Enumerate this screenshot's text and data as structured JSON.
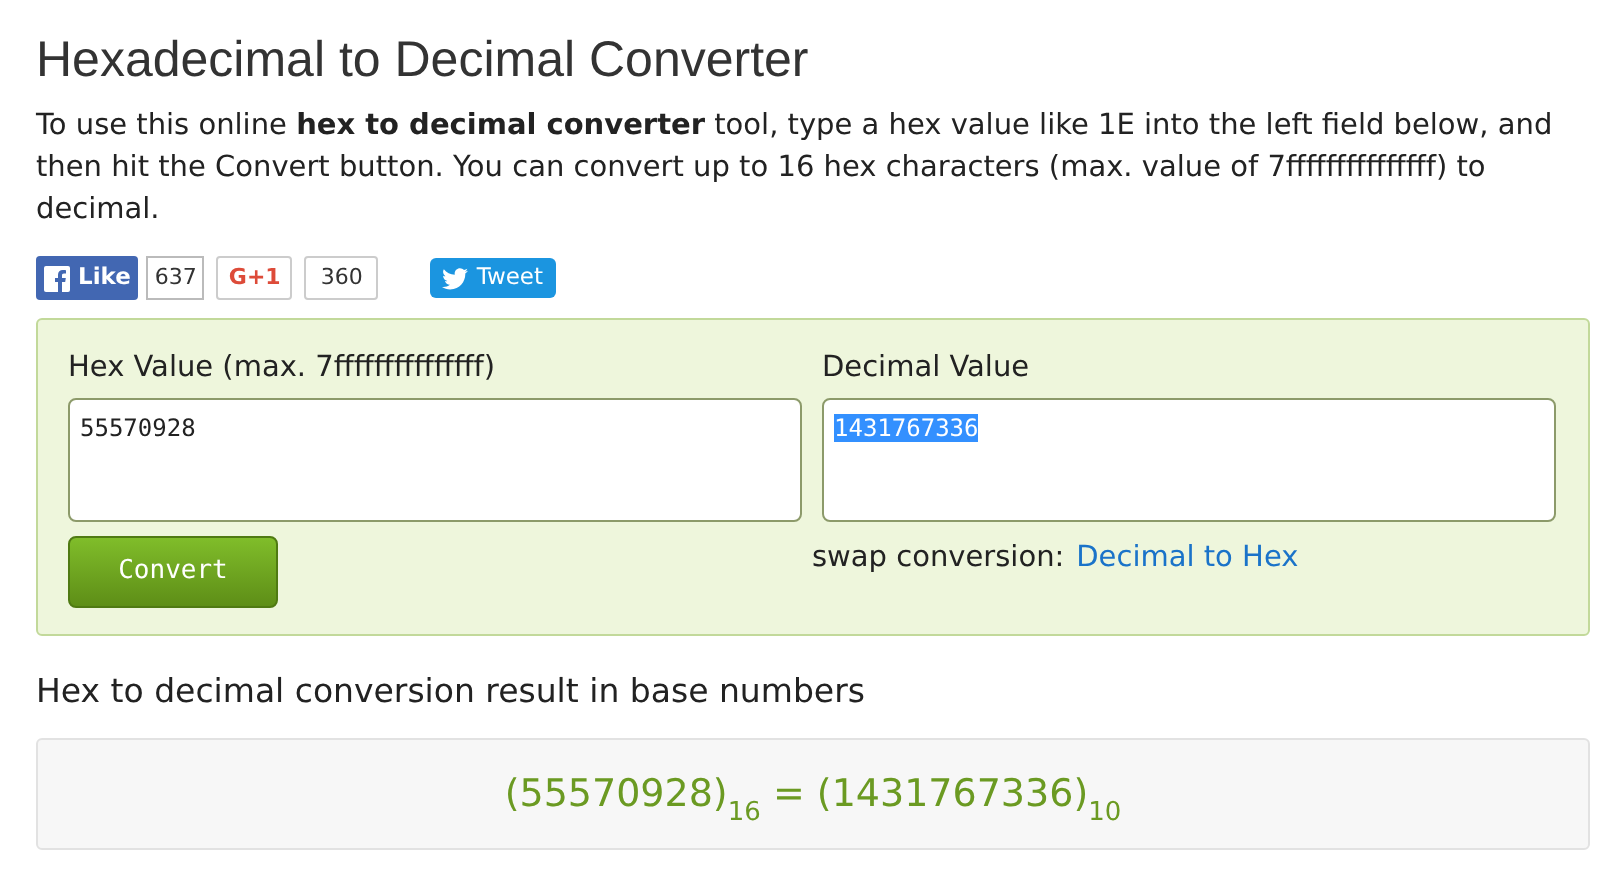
{
  "title": "Hexadecimal to Decimal Converter",
  "intro": "To use this online **hex to decimal converter** tool, type a hex value like 1E into the left field below, and then hit the Convert button. You can convert up to 16 hex characters (max. value of 7fffffffffffffff) to decimal.",
  "social": [
    {
      "kind": "facebook",
      "label": "Like",
      "count": "637"
    },
    {
      "kind": "gplus",
      "label": "G+1",
      "count": "360"
    },
    {
      "kind": "twitter",
      "label": "Tweet"
    }
  ],
  "converter": {
    "hex_label": "Hex Value (max. 7fffffffffffffff)",
    "hex_value": "55570928",
    "decimal_label": "Decimal Value",
    "decimal_value": "1431767336",
    "decimal_selected": true,
    "convert_button": "Convert",
    "swap_label": "swap conversion:",
    "swap_link": "Decimal to Hex"
  },
  "result": {
    "heading": "Hex to decimal conversion result in base numbers",
    "equation": "(55570928)$_{16}$ = (1431767336)$_{10}$"
  }
}
